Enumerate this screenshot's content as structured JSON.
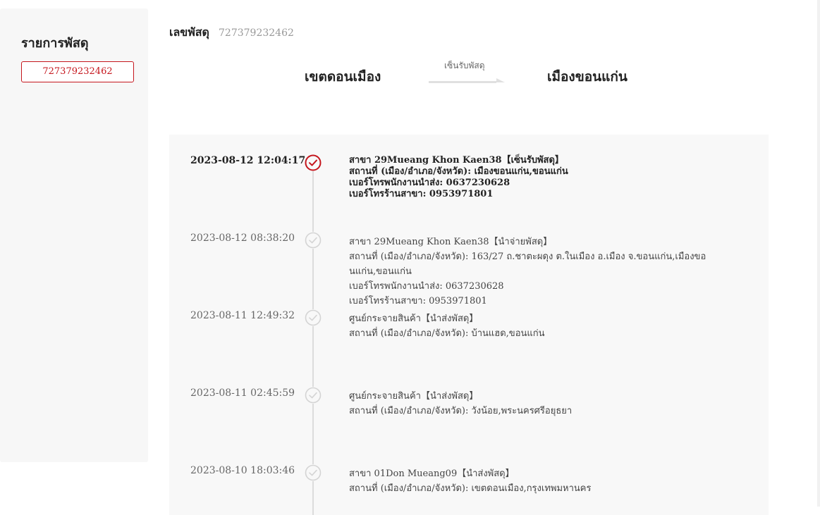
{
  "sidebar": {
    "title": "รายการพัสดุ",
    "tracking_numbers": [
      "727379232462"
    ]
  },
  "parcel": {
    "label": "เลขพัสดุ",
    "number": "727379232462"
  },
  "route": {
    "origin": "เขตดอนเมือง",
    "destination": "เมืองขอนแก่น",
    "status": "เซ็นรับพัสดุ"
  },
  "events": [
    {
      "time": "2023-08-12 12:04:17",
      "lines": [
        "สาขา 29Mueang Khon Kaen38【เซ็นรับพัสดุ】",
        "สถานที่ (เมือง/อำเภอ/จังหวัด):  เมืองขอนแก่น,ขอนแก่น",
        "เบอร์โทรพนักงานนำส่ง: 0637230628",
        "เบอร์โทรร้านสาขา: 0953971801"
      ]
    },
    {
      "time": "2023-08-12 08:38:20",
      "lines": [
        "สาขา 29Mueang Khon Kaen38【นำจ่ายพัสดุ】",
        "สถานที่ (เมือง/อำเภอ/จังหวัด):  163/27 ถ.ชาตะผดุง ต.ในเมือง อ.เมือง จ.ขอนแก่น,เมืองขอนแก่น,ขอนแก่น",
        "เบอร์โทรพนักงานนำส่ง: 0637230628",
        "เบอร์โทรร้านสาขา: 0953971801"
      ]
    },
    {
      "time": "2023-08-11 12:49:32",
      "lines": [
        "ศูนย์กระจายสินค้า【นำส่งพัสดุ】",
        "สถานที่ (เมือง/อำเภอ/จังหวัด):  บ้านแฮด,ขอนแก่น"
      ]
    },
    {
      "time": "2023-08-11 02:45:59",
      "lines": [
        "ศูนย์กระจายสินค้า【นำส่งพัสดุ】",
        "สถานที่ (เมือง/อำเภอ/จังหวัด):  วังน้อย,พระนครศรีอยุธยา"
      ]
    },
    {
      "time": "2023-08-10 18:03:46",
      "lines": [
        "สาขา 01Don Mueang09【นำส่งพัสดุ】",
        "สถานที่ (เมือง/อำเภอ/จังหวัด):  เขตดอนเมือง,กรุงเทพมหานคร"
      ]
    }
  ],
  "colors": {
    "accent": "#c5161d",
    "marker_inactive": "#d4d4d4",
    "timeline_bg": "#f8f8f8"
  },
  "icons": {
    "current": "check-circle-icon",
    "past": "check-circle-icon",
    "route": "arrow-right-icon"
  }
}
